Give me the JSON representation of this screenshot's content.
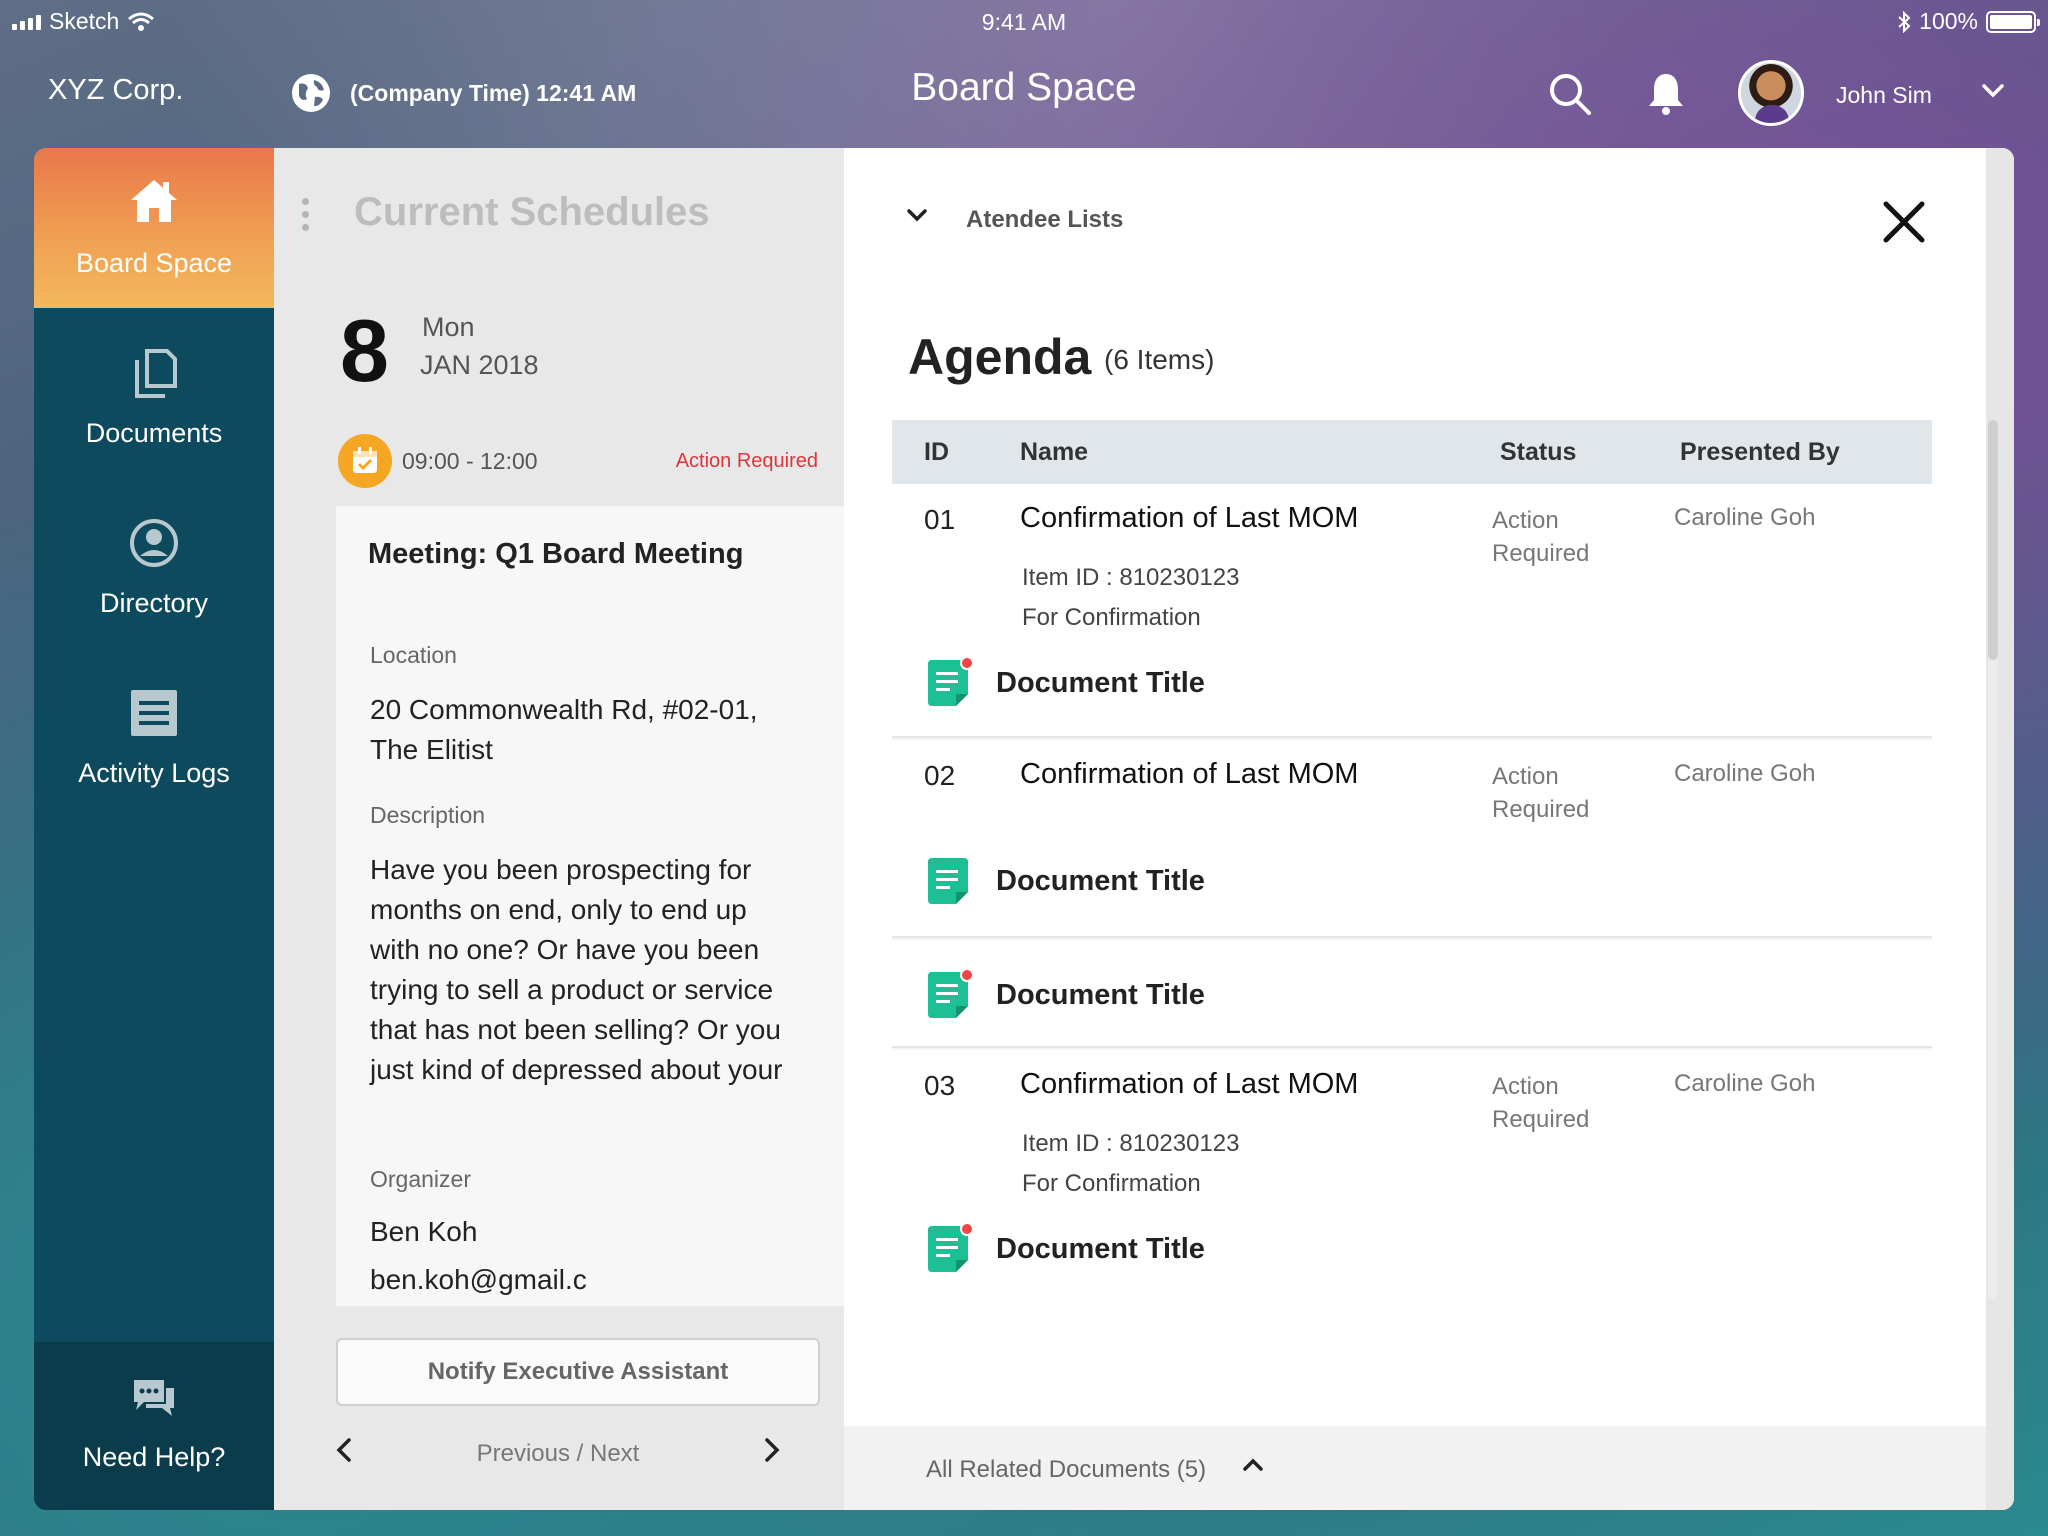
{
  "status_bar": {
    "carrier": "Sketch",
    "time": "9:41 AM",
    "battery": "100%"
  },
  "header": {
    "company": "XYZ Corp.",
    "company_time": "(Company Time) 12:41 AM",
    "title": "Board Space",
    "user_name": "John Sim",
    "icons": [
      "globe-icon",
      "search-icon",
      "bell-icon",
      "chevron-down-icon"
    ]
  },
  "sidebar": {
    "items": [
      {
        "label": "Board Space",
        "icon": "home-icon",
        "active": true
      },
      {
        "label": "Documents",
        "icon": "documents-icon",
        "active": false
      },
      {
        "label": "Directory",
        "icon": "user-circle-icon",
        "active": false
      },
      {
        "label": "Activity Logs",
        "icon": "list-icon",
        "active": false
      }
    ],
    "help_label": "Need Help?",
    "accent_gradient": [
      "#e9784a",
      "#f4b85c"
    ],
    "background": "#0e4a5d"
  },
  "schedule": {
    "title": "Current Schedules",
    "day_number": "8",
    "day_name": "Mon",
    "month_year": "JAN 2018",
    "time_range": "09:00 - 12:00",
    "status": "Action Required",
    "meeting": "Meeting: Q1 Board Meeting",
    "location_label": "Location",
    "location_value": "20 Commonwealth Rd, #02-01, The Elitist",
    "description_label": "Description",
    "description_value": "Have you been prospecting for months on end, only to end up with no one? Or have you been trying to sell a product or service that has not been selling? Or you just kind of depressed about your",
    "organizer_label": "Organizer",
    "organizer_name": "Ben Koh",
    "organizer_email": "ben.koh@gmail.c",
    "notify_button": "Notify Executive Assistant",
    "pager_label": "Previous / Next"
  },
  "agenda": {
    "attendee_label": "Atendee Lists",
    "title": "Agenda",
    "count": "(6 Items)",
    "columns": [
      "ID",
      "Name",
      "Status",
      "Presented By"
    ],
    "rows": [
      {
        "id": "01",
        "name": "Confirmation of Last MOM",
        "status": "Action Required",
        "presenter": "Caroline Goh",
        "item_id": "Item ID : 810230123",
        "purpose": "For Confirmation",
        "doc": "Document Title",
        "doc_alert": true
      },
      {
        "id": "02",
        "name": "Confirmation of Last MOM",
        "status": "Action Required",
        "presenter": "Caroline Goh",
        "doc": "Document Title",
        "doc_alert": false
      },
      {
        "doc": "Document Title",
        "doc_alert": true
      },
      {
        "id": "03",
        "name": "Confirmation of Last MOM",
        "status": "Action Required",
        "presenter": "Caroline Goh",
        "item_id": "Item ID : 810230123",
        "purpose": "For Confirmation",
        "doc": "Document Title",
        "doc_alert": true
      }
    ],
    "related_docs": "All Related Documents (5)",
    "doc_icon_color": "#1dbf95",
    "alert_color": "#f04545"
  }
}
